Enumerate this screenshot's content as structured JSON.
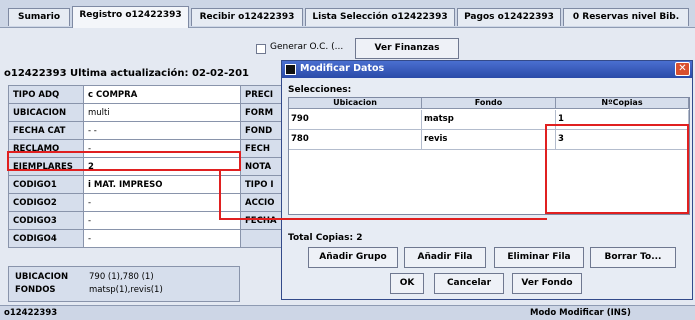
{
  "tabs": [
    {
      "label": "Sumario"
    },
    {
      "label": "Registro o12422393"
    },
    {
      "label": "Recibir o12422393"
    },
    {
      "label": "Lista Selección o12422393"
    },
    {
      "label": "Pagos o12422393"
    },
    {
      "label": "0 Reservas nivel Bib."
    }
  ],
  "toolbar": {
    "generar_label": "Generar O.C. (...",
    "finanzas_label": "Ver Finanzas"
  },
  "record": {
    "header": "o12422393    Ultima actualización: 02-02-201",
    "fields": [
      {
        "key": "TIPO ADQ",
        "value": "c  COMPRA",
        "key2": "PRECI"
      },
      {
        "key": "UBICACION",
        "value": "multi",
        "key2": "FORM"
      },
      {
        "key": "FECHA CAT",
        "value": "- -",
        "key2": "FOND"
      },
      {
        "key": "RECLAMO",
        "value": "-",
        "key2": "FECH"
      },
      {
        "key": "EJEMPLARES",
        "value": "2",
        "key2": "NOTA"
      },
      {
        "key": "CODIGO1",
        "value": "i  MAT. IMPRESO",
        "key2": "TIPO I"
      },
      {
        "key": "CODIGO2",
        "value": "-",
        "key2": "ACCIO"
      },
      {
        "key": "CODIGO3",
        "value": "-",
        "key2": "FECHA"
      },
      {
        "key": "CODIGO4",
        "value": "-",
        "key2": ""
      }
    ],
    "summary_ubicacion_key": "UBICACION",
    "summary_ubicacion_val": "790 (1),780 (1)",
    "summary_fondos_key": "FONDOS",
    "summary_fondos_val": "matsp(1),revis(1)"
  },
  "dialog": {
    "title": "Modificar Datos",
    "selections_label": "Selecciones:",
    "columns": [
      "Ubicacion",
      "Fondo",
      "NºCopias"
    ],
    "rows": [
      {
        "ubicacion": "790",
        "fondo": "matsp",
        "copias": "1"
      },
      {
        "ubicacion": "780",
        "fondo": "revis",
        "copias": "3"
      }
    ],
    "total_label": "Total Copias: 2",
    "buttons": {
      "add_group": "Añadir Grupo",
      "add_row": "Añadir Fila",
      "delete_row": "Eliminar Fila",
      "clear_all": "Borrar To...",
      "ok": "OK",
      "cancel": "Cancelar",
      "view_fund": "Ver Fondo"
    }
  },
  "status": {
    "record_id": "o12422393",
    "mode": "Modo Modificar (INS)"
  },
  "colors": {
    "highlight": "#e02020",
    "title_bar": "#2a4aa8"
  }
}
